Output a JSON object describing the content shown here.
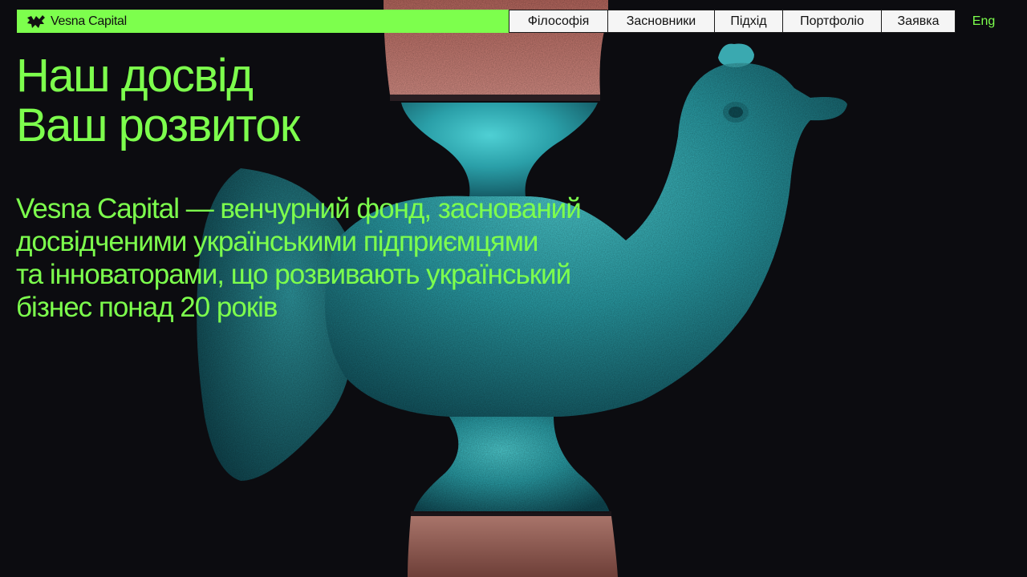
{
  "header": {
    "brand_name": "Vesna Capital",
    "nav": [
      {
        "label": "Філософія"
      },
      {
        "label": "Засновники"
      },
      {
        "label": "Підхід"
      },
      {
        "label": "Портфоліо"
      },
      {
        "label": "Заявка"
      }
    ],
    "language": "Eng"
  },
  "hero": {
    "title_lines": [
      "Наш досвід",
      "Ваш розвиток"
    ],
    "description_lines": [
      "Vesna Capital — венчурний фонд, заснований",
      "досвідченими українськими підприємцями",
      "та інноваторами, що розвивають український",
      "бізнес понад 20 років"
    ],
    "image_subject": "turquoise-ceramic-bird-figurine"
  },
  "colors": {
    "accent": "#7dff4d",
    "background": "#0c0c10",
    "nav_background": "#f5f5f5",
    "figurine_turquoise": "#2aa0a8",
    "terracotta": "#c47a72"
  }
}
